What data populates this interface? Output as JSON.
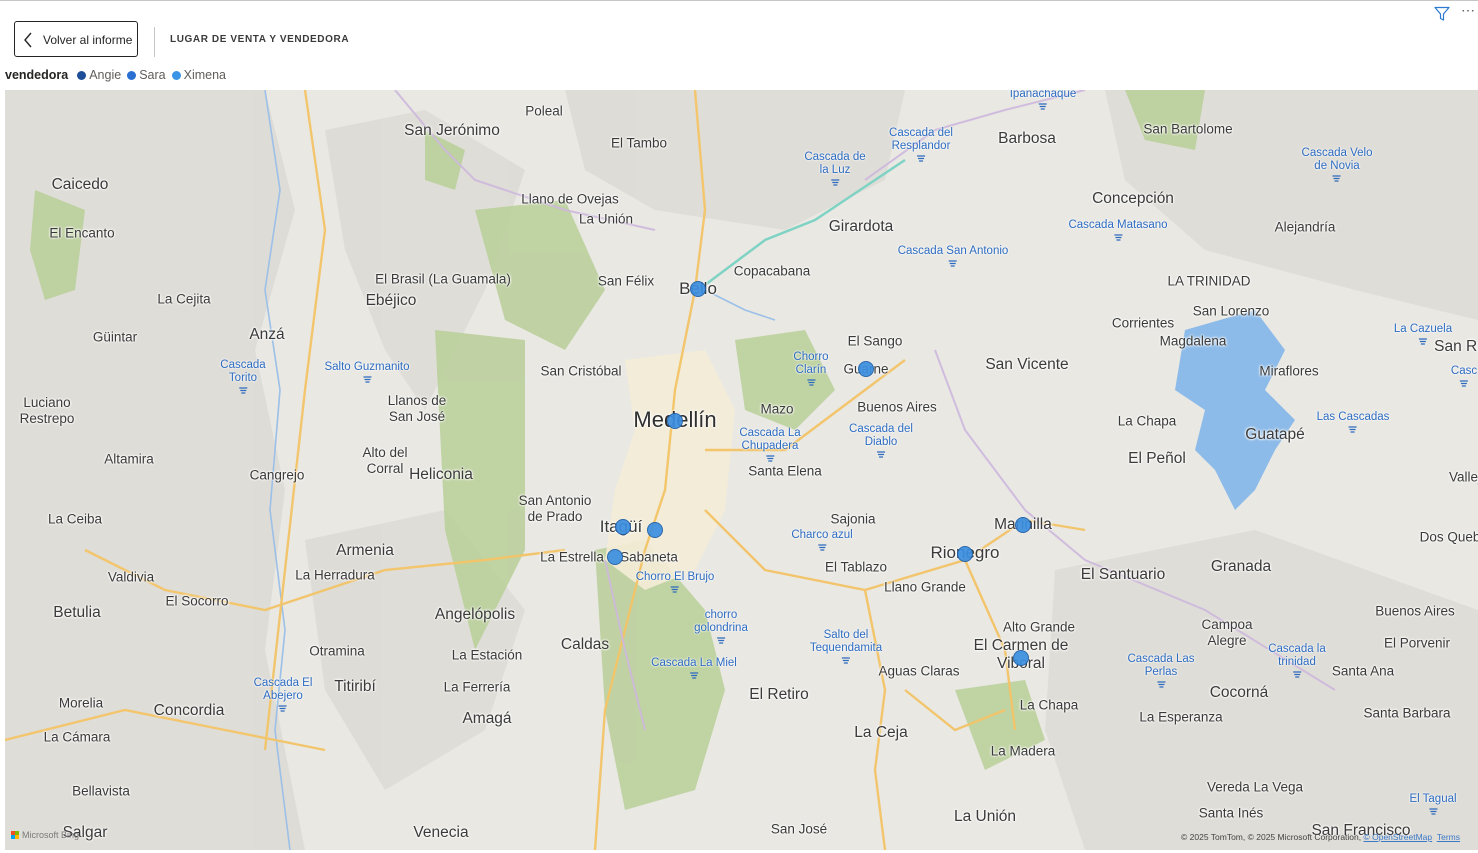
{
  "header": {
    "back_button_label": "Volver al informe",
    "page_title": "LUGAR DE VENTA Y VENDEDORA"
  },
  "legend": {
    "title": "vendedora",
    "items": [
      {
        "label": "Angie",
        "color": "#1f4e99"
      },
      {
        "label": "Sara",
        "color": "#2a6fd1"
      },
      {
        "label": "Ximena",
        "color": "#3b95e6"
      }
    ]
  },
  "map": {
    "marker_color": "#3b8ee0",
    "places": {
      "poleal": "Poleal",
      "san_jeronimo": "San Jerónimo",
      "el_tambo": "El Tambo",
      "caicedo": "Caicedo",
      "llano_de_ovejas": "Llano de Ovejas",
      "la_union_n": "La Unión",
      "el_encanto": "El Encanto",
      "el_brasil": "El Brasil (La Guamala)",
      "san_felix": "San Félix",
      "bello": "Bello",
      "copacabana": "Copacabana",
      "girardota": "Girardota",
      "barbosa": "Barbosa",
      "san_bartolome": "San Bartolome",
      "concepcion": "Concepción",
      "alejandria": "Alejandría",
      "la_trinidad": "LA TRINIDAD",
      "san_lorenzo": "San Lorenzo",
      "corrientes": "Corrientes",
      "magdalena": "Magdalena",
      "la_cejita": "La Cejita",
      "ebejico": "Ebéjico",
      "anza": "Anzá",
      "guintar": "Güintar",
      "san_cristobal": "San Cristóbal",
      "el_sango": "El Sango",
      "guarne": "Guarne",
      "san_vicente": "San Vicente",
      "miraflores": "Miraflores",
      "san_ra": "San Ra",
      "medellin": "Medellín",
      "mazo": "Mazo",
      "buenos_aires_n": "Buenos Aires",
      "la_chapa_n": "La Chapa",
      "guatape": "Guatapé",
      "luciano_restrepo": "Luciano\nRestrepo",
      "llanos_de_san_jose": "Llanos de\nSan José",
      "altamira": "Altamira",
      "cangrejo": "Cangrejo",
      "alto_del_corral": "Alto del\nCorral",
      "heliconia": "Heliconia",
      "santa_elena": "Santa Elena",
      "el_penol": "El Peñol",
      "vallej": "Vallej",
      "la_ceiba": "La Ceiba",
      "san_antonio_de_prado": "San Antonio\nde Prado",
      "itagui": "Itagüí",
      "sajonia": "Sajonia",
      "marinilla": "Marinilla",
      "dos_queb": "Dos Queb",
      "armenia": "Armenia",
      "la_estrella": "La Estrella",
      "sabaneta": "Sabaneta",
      "rionegro": "Rionegro",
      "valdivia": "Valdivia",
      "la_herradura": "La Herradura",
      "el_tablazo": "El Tablazo",
      "el_santuario": "El Santuario",
      "granada": "Granada",
      "llano_grande": "Llano Grande",
      "betulia": "Betulia",
      "el_socorro": "El Socorro",
      "angelopolis": "Angelópolis",
      "buenos_aires_e": "Buenos Aires",
      "alto_grande": "Alto Grande",
      "campoa_alegre": "Campoa\nAlegre",
      "caldas": "Caldas",
      "otramina": "Otramina",
      "la_estacion": "La Estación",
      "el_carmen": "El Carmen de\nViboral",
      "el_porvenir": "El Porvenir",
      "aguas_claras": "Aguas Claras",
      "santa_ana": "Santa Ana",
      "titiribi": "Titiribí",
      "la_ferreria": "La Ferrería",
      "el_retiro": "El Retiro",
      "morelia": "Morelia",
      "cocorna": "Cocorná",
      "concordia": "Concordia",
      "amaga": "Amagá",
      "la_chapa_s": "La Chapa",
      "santa_barbara": "Santa Barbara",
      "la_esperanza": "La Esperanza",
      "la_camara": "La Cámara",
      "la_ceja": "La Ceja",
      "la_madera": "La Madera",
      "bellavista": "Bellavista",
      "vereda_la_vega": "Vereda La Vega",
      "santa_ines": "Santa Inés",
      "salgar": "Salgar",
      "venecia": "Venecia",
      "san_jose": "San José",
      "la_union_s": "La Unión",
      "san_francisco": "San Francisco"
    },
    "pois": {
      "ipanachaque": "Ipanachaque",
      "resplandor": "Cascada del\nResplandor",
      "la_luz": "Cascada de\nla Luz",
      "velo_novia": "Cascada Velo\nde Novia",
      "matasano": "Cascada Matasano",
      "san_antonio": "Cascada San Antonio",
      "la_cazuela": "La Cazuela",
      "torito": "Cascada\nTorito",
      "guzmanito": "Salto Guzmanito",
      "chorro_clarin": "Chorro\nClarín",
      "casc_e": "Casc",
      "las_cascadas": "Las Cascadas",
      "chupadera": "Cascada La\nChupadera",
      "diablo": "Cascada del\nDiablo",
      "charco_azul": "Charco azul",
      "el_brujo": "Chorro El Brujo",
      "golondrina": "chorro\ngolondrina",
      "tequendamita": "Salto del\nTequendamita",
      "la_miel": "Cascada La Miel",
      "las_perlas": "Cascada Las\nPerlas",
      "la_trinidad": "Cascada la\ntrinidad",
      "abejero": "Cascada El\nAbejero",
      "el_tagual": "El Tagual"
    },
    "ms_logo_text": "Microsoft Bing",
    "attribution": "© 2025 TomTom, © 2025 Microsoft Corporation, ",
    "osm_link": "© OpenStreetMap",
    "terms_link": "Terms"
  }
}
